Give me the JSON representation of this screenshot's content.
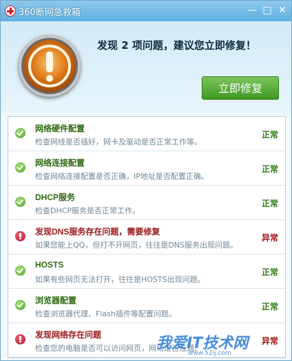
{
  "window": {
    "title": "360断网急救箱",
    "min_glyph": "—",
    "max_glyph": "□",
    "close_glyph": "✕"
  },
  "header": {
    "headline": "发现 2 项问题，建议您立即修复！",
    "fix_button_label": "立即修复"
  },
  "checks": [
    {
      "name": "网络硬件配置",
      "desc": "检查网线是否插好，网卡及驱动是否正常工作等。",
      "status": "正常",
      "ok": true
    },
    {
      "name": "网络连接配置",
      "desc": "检查网络连接配置是否正确，IP地址是否配置正确。",
      "status": "正常",
      "ok": true
    },
    {
      "name": "DHCP服务",
      "desc": "检查DHCP服务是否正常工作。",
      "status": "正常",
      "ok": true
    },
    {
      "name": "发现DNS服务存在问题，需要修复",
      "desc": "如果您能上QQ，但打不开网页，往往是DNS服务出现问题。",
      "status": "异常",
      "ok": false
    },
    {
      "name": "HOSTS",
      "desc": "如果有些网页无法打开，往往是HOSTS出现问题。",
      "status": "正常",
      "ok": true
    },
    {
      "name": "浏览器配置",
      "desc": "检查浏览器代理、Flash插件等配置问题。",
      "status": "正常",
      "ok": true
    },
    {
      "name": "发现网络存在问题",
      "desc": "检查您的电脑是否可以访问网页，网络是否连通。",
      "status": "异常",
      "ok": false
    }
  ],
  "watermark": {
    "logo": "我爱IT技术网",
    "url": "www.52ij.com"
  },
  "icons": {
    "app": "first-aid-icon",
    "alert": "warning-icon",
    "ok": "check-circle-icon",
    "warn": "exclamation-circle-icon"
  },
  "colors": {
    "accent": "#4aa322",
    "error": "#b0102a",
    "titlebar": "#5fb0e0"
  }
}
